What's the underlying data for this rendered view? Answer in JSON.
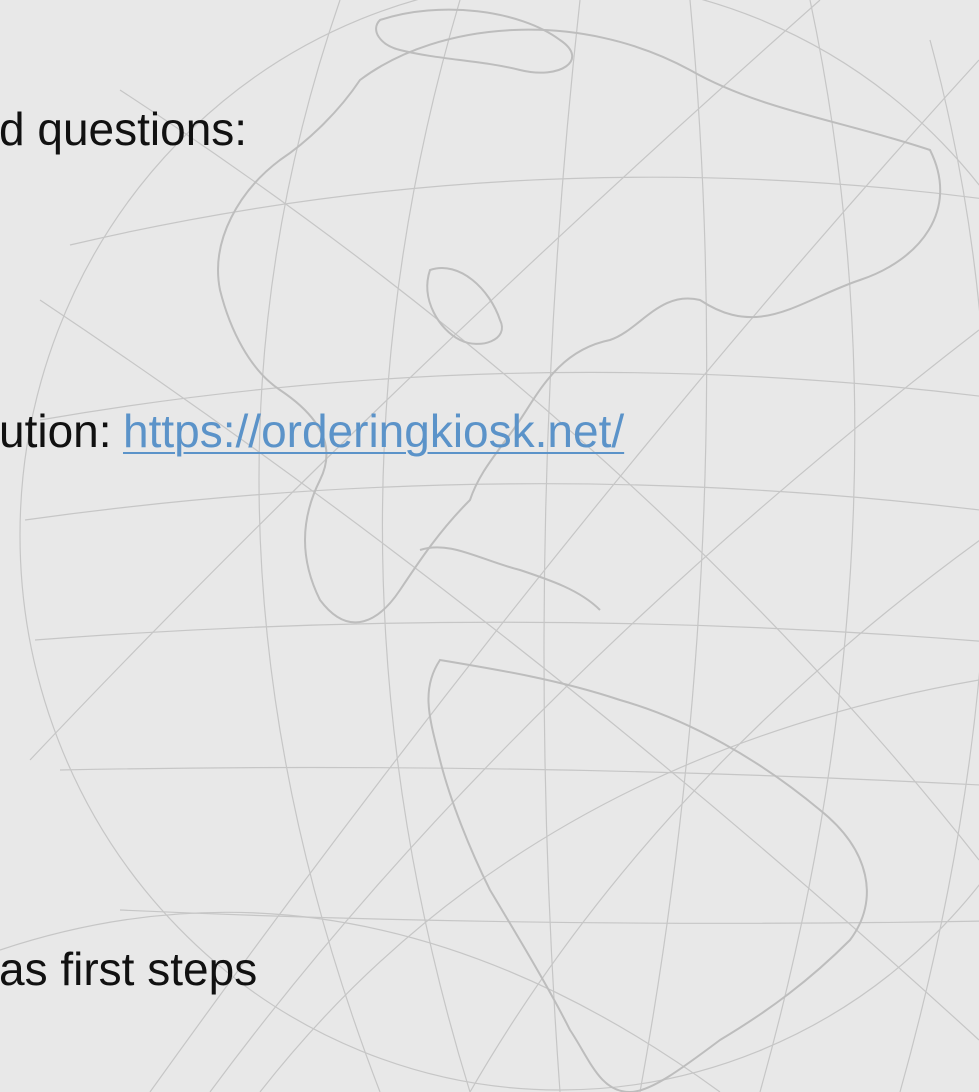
{
  "lines": {
    "questions": "d questions:",
    "solution_prefix": "ution:",
    "solution_link": "https://orderingkiosk.net/",
    "first_steps": "as first steps"
  },
  "colors": {
    "background": "#e8e8e8",
    "text": "#111111",
    "link": "#5b93c9",
    "globe_lines": "#c4c4c4"
  },
  "icons": {
    "background_art": "globe-wireframe-icon"
  }
}
